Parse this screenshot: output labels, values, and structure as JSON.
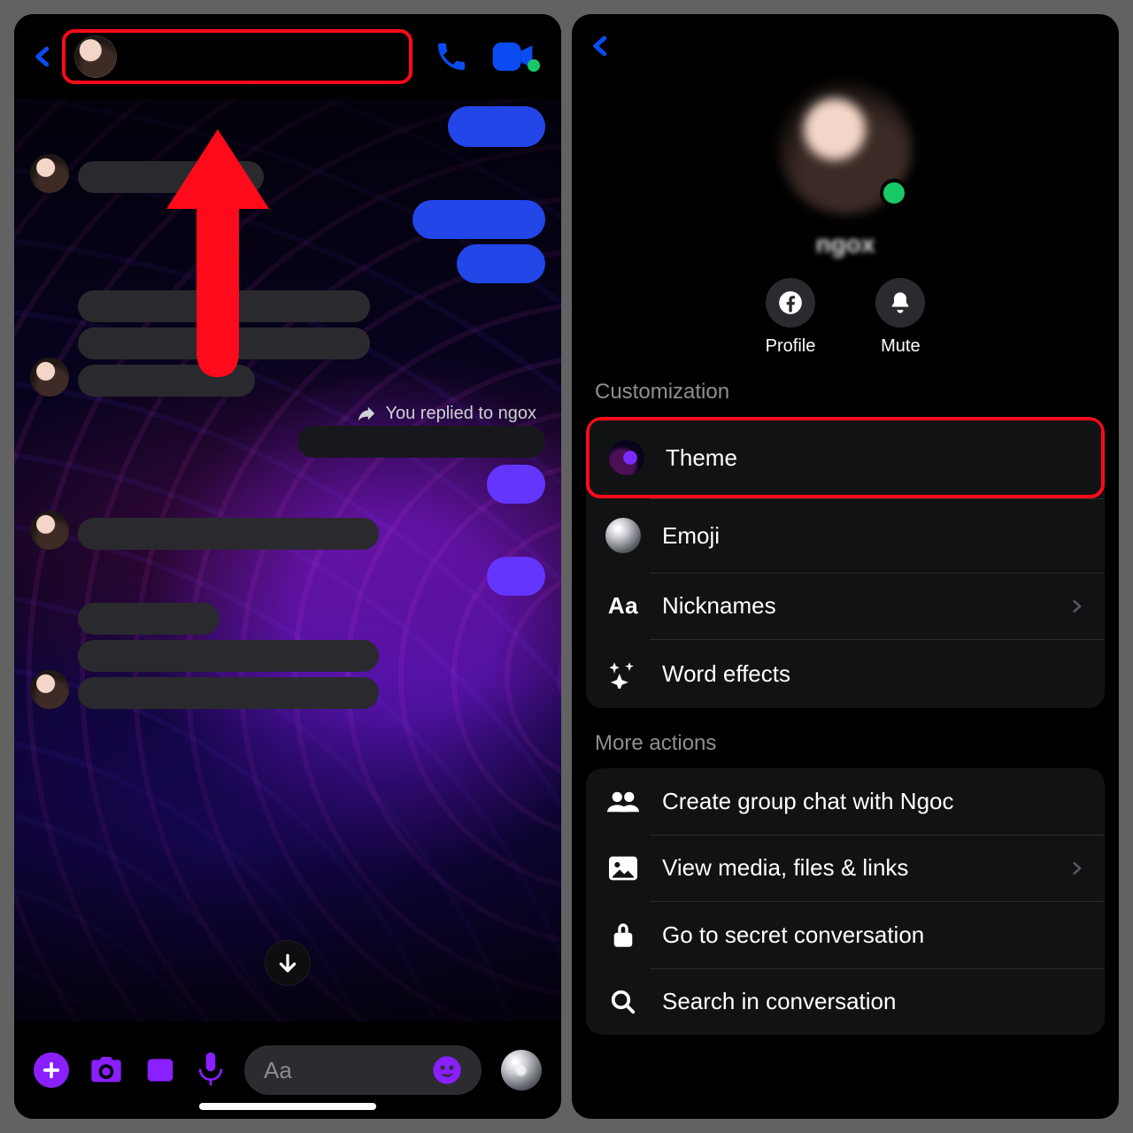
{
  "left": {
    "colors": {
      "accent": "#8a1fff",
      "blue": "#0a4cf1",
      "red": "#ff0a1a",
      "online": "#17c964"
    },
    "reply_preview": "You replied to ngox",
    "composer_placeholder": "Aa"
  },
  "right": {
    "profile_name": "ngox",
    "hero_actions": {
      "profile": "Profile",
      "mute": "Mute"
    },
    "sections": {
      "customization": "Customization",
      "more_actions": "More actions"
    },
    "customization": {
      "theme": "Theme",
      "emoji": "Emoji",
      "nicknames": "Nicknames",
      "word_effects": "Word effects"
    },
    "more_actions": {
      "create_group": "Create group chat with Ngoc",
      "view_media": "View media, files & links",
      "secret": "Go to secret conversation",
      "search": "Search in conversation"
    }
  }
}
